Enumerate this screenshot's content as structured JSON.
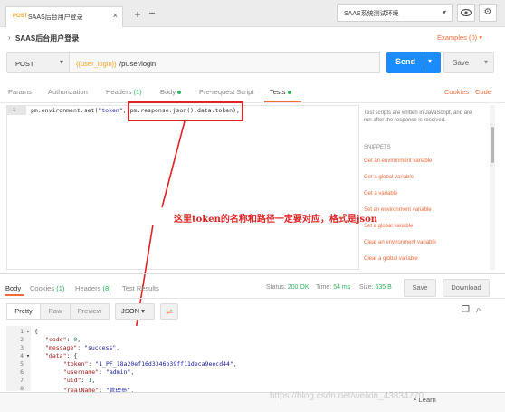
{
  "colors": {
    "accent": "#f26b3a",
    "send_blue": "#1a8cff",
    "status_green": "#2db35d",
    "method_orange": "#f5a623",
    "annotation_red": "#e02424"
  },
  "tabbar": {
    "tab": {
      "method": "POST",
      "title": "SAAS后台用户登录",
      "close": "×"
    },
    "add": "+",
    "more": "•••",
    "environment": "SAAS系统测试环境",
    "eye_icon": "eye-icon",
    "gear_icon": "gear-icon"
  },
  "request": {
    "title": "SAAS后台用户登录",
    "examples": "Examples (0)",
    "method": "POST",
    "url_variable": "{{user_login}}",
    "url_path": "/pUser/login",
    "send": "Send",
    "save": "Save"
  },
  "request_tabs": [
    {
      "label": "Params"
    },
    {
      "label": "Authorization"
    },
    {
      "label": "Headers",
      "count": "(1)"
    },
    {
      "label": "Body"
    },
    {
      "label": "Pre-request Script"
    },
    {
      "label": "Tests"
    }
  ],
  "links": {
    "cookies": "Cookies",
    "code": "Code"
  },
  "editor": {
    "line_number": "1",
    "code_part1": "pm.environment.set(",
    "code_str": "\"token\"",
    "code_part2": ", pm.response.json().data.token);"
  },
  "helper_text": "Test scripts are written in JavaScript, and are run after the response is received.",
  "snippets": {
    "title": "SNIPPETS",
    "items": [
      "Get an environment variable",
      "Get a global variable",
      "Get a variable",
      "Set an environment variable",
      "Set a global variable",
      "Clear an environment variable",
      "Clear a global variable"
    ]
  },
  "annotation": "这里token的名称和路径一定要对应，格式是json",
  "response": {
    "tabs": [
      {
        "label": "Body"
      },
      {
        "label": "Cookies",
        "count": "(1)"
      },
      {
        "label": "Headers",
        "count": "(8)"
      },
      {
        "label": "Test Results"
      }
    ],
    "status_label": "Status:",
    "status_value": "200 OK",
    "time_label": "Time:",
    "time_value": "54 ms",
    "size_label": "Size:",
    "size_value": "635 B",
    "save_response": "Save",
    "download": "Download",
    "views": [
      "Pretty",
      "Raw",
      "Preview"
    ],
    "format": "JSON"
  },
  "json_lines": [
    {
      "n": "1",
      "fold": "▾",
      "text": "{"
    },
    {
      "n": "2",
      "key": "\"code\"",
      "sep": ": ",
      "num": "0",
      "end": ","
    },
    {
      "n": "3",
      "key": "\"message\"",
      "sep": ": ",
      "str": "\"success\"",
      "end": ","
    },
    {
      "n": "4",
      "fold": "▾",
      "key": "\"data\"",
      "sep": ": ",
      "end": "{"
    },
    {
      "n": "5",
      "key": "\"token\"",
      "sep": ": ",
      "str": "\"1_PF_18a20ef16d3346b39ff11deca9eecd44\"",
      "end": ","
    },
    {
      "n": "6",
      "key": "\"username\"",
      "sep": ": ",
      "str": "\"admin\"",
      "end": ","
    },
    {
      "n": "7",
      "key": "\"uid\"",
      "sep": ": ",
      "num": "1",
      "end": ","
    },
    {
      "n": "8",
      "key": "\"realName\"",
      "sep": ": ",
      "str": "\"管理员\"",
      "end": ","
    }
  ],
  "bottom": {
    "learn": "Learn",
    "watermark": "https://blog.csdn.net/weixin_43834770"
  }
}
